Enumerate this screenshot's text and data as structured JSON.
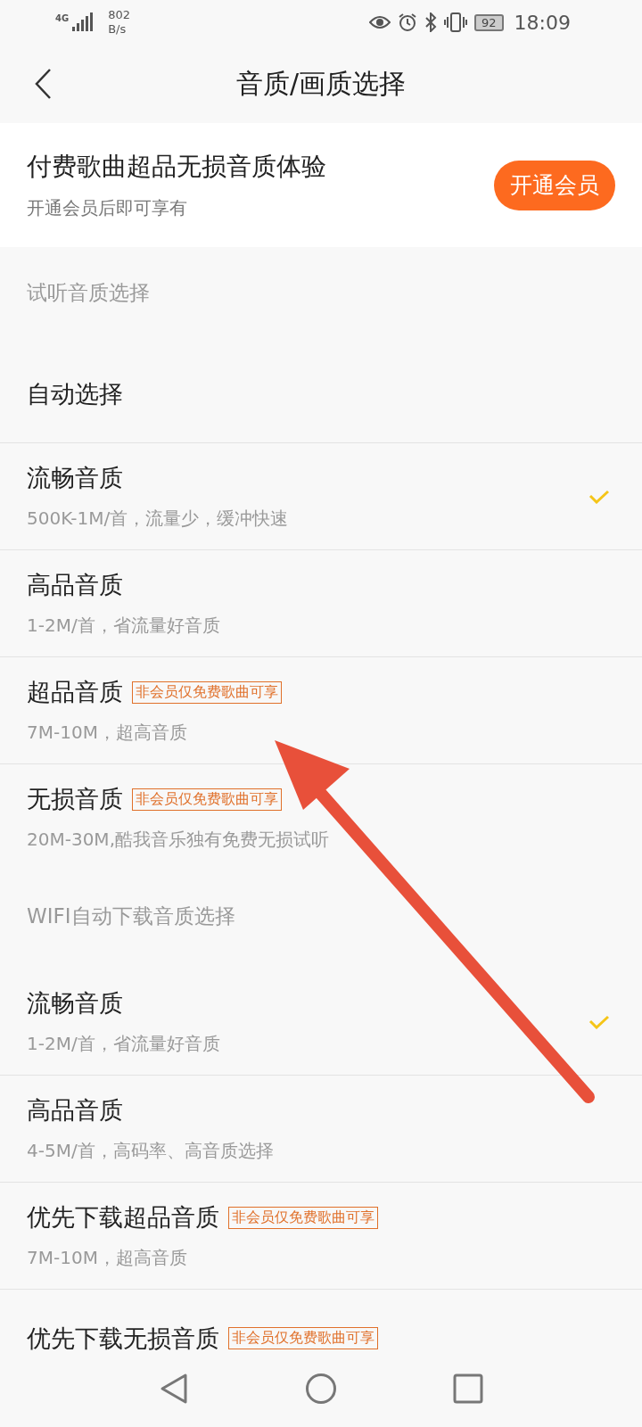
{
  "status_bar": {
    "network": "4G",
    "speed_value": "802",
    "speed_unit": "B/s",
    "battery": "92",
    "time": "18:09"
  },
  "header": {
    "title": "音质/画质选择"
  },
  "promo": {
    "title": "付费歌曲超品无损音质体验",
    "subtitle": "开通会员后即可享有",
    "button": "开通会员"
  },
  "sections": [
    {
      "title": "试听音质选择",
      "options": [
        {
          "title": "自动选择",
          "checked": false
        },
        {
          "title": "流畅音质",
          "subtitle": "500K-1M/首，流量少，缓冲快速",
          "checked": true
        },
        {
          "title": "高品音质",
          "subtitle": "1-2M/首，省流量好音质",
          "checked": false
        },
        {
          "title": "超品音质",
          "badge": "非会员仅免费歌曲可享",
          "subtitle": "7M-10M，超高音质",
          "checked": false
        },
        {
          "title": "无损音质",
          "badge": "非会员仅免费歌曲可享",
          "subtitle": "20M-30M,酷我音乐独有免费无损试听",
          "checked": false
        }
      ]
    },
    {
      "title": "WIFI自动下载音质选择",
      "options": [
        {
          "title": "流畅音质",
          "subtitle": "1-2M/首，省流量好音质",
          "checked": true
        },
        {
          "title": "高品音质",
          "subtitle": "4-5M/首，高码率、高音质选择",
          "checked": false
        },
        {
          "title": "优先下载超品音质",
          "badge": "非会员仅免费歌曲可享",
          "subtitle": "7M-10M，超高音质",
          "checked": false
        },
        {
          "title": "优先下载无损音质",
          "badge": "非会员仅免费歌曲可享",
          "checked": false
        }
      ]
    }
  ]
}
